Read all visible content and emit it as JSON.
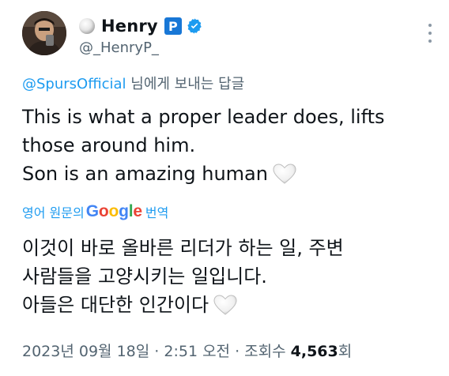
{
  "user": {
    "display_name": "Henry",
    "handle": "@_HenryP_",
    "badge_letter": "P",
    "verified": true,
    "badge_color": "#1877d6",
    "verified_color": "#1d9bf0"
  },
  "reply": {
    "mention": "@SpursOfficial",
    "suffix": " 님에게 보내는 답글"
  },
  "tweet": {
    "lines": [
      "This is what a proper leader does, lifts",
      "those around him.",
      "Son is an amazing human"
    ]
  },
  "translation": {
    "prefix": "영어 원문의",
    "google": "Google",
    "suffix": "번역",
    "lines": [
      "이것이 바로 올바른 리더가 하는 일, 주변",
      "사람들을 고양시키는 일입니다.",
      "아들은 대단한 인간이다"
    ]
  },
  "meta": {
    "date": "2023년 09월 18일",
    "sep1": " · ",
    "time": "2:51 오전",
    "sep2": " · ",
    "views_label": "조회수 ",
    "views_count": "4,563",
    "views_suffix": "회"
  },
  "colors": {
    "link": "#1d9bf0",
    "secondary_text": "#536471",
    "primary_text": "#0f1419"
  },
  "icons": {
    "more": "more-options-icon",
    "heart": "white-heart-icon",
    "moon": "full-moon-icon",
    "verified": "verified-badge-icon"
  }
}
